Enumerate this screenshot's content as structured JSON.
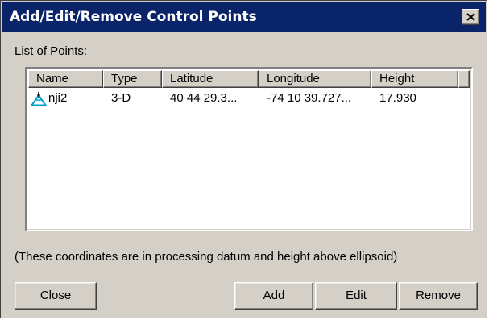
{
  "window": {
    "title": "Add/Edit/Remove Control Points",
    "close_glyph": "x-icon"
  },
  "list": {
    "label": "List of Points:",
    "columns": [
      "Name",
      "Type",
      "Latitude",
      "Longitude",
      "Height"
    ],
    "rows": [
      {
        "icon": "control-point-triangle-icon",
        "name": "nji2",
        "type": "3-D",
        "latitude": "40 44 29.3...",
        "longitude": "-74 10 39.727...",
        "height": "17.930"
      }
    ]
  },
  "note": "(These coordinates are in processing datum and height above ellipsoid)",
  "buttons": {
    "close": "Close",
    "add": "Add",
    "edit": "Edit",
    "remove": "Remove"
  },
  "colors": {
    "titlebar": "#0a246a",
    "face": "#d4d0c8",
    "icon_cyan": "#00a0c8"
  }
}
